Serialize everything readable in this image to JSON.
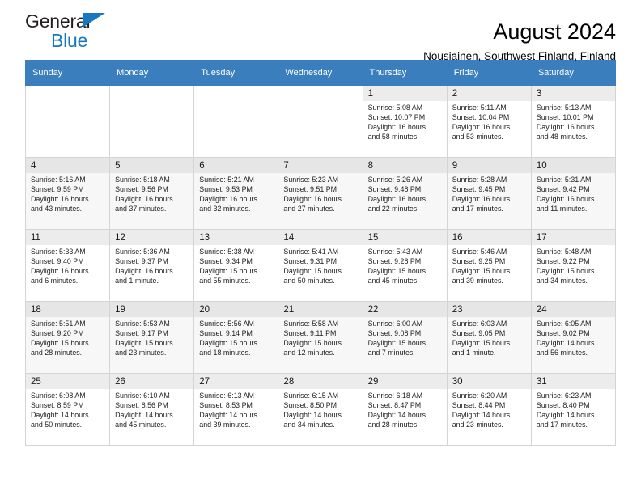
{
  "brand": {
    "line1": "General",
    "line2": "Blue",
    "accent_color": "#1878be",
    "triangle_icon": "brand-triangle-icon"
  },
  "header": {
    "title": "August 2024",
    "subtitle": "Nousiainen, Southwest Finland, Finland"
  },
  "theme": {
    "header_row_bg": "#3a7ebe",
    "header_row_text": "#ffffff",
    "alt_row_bg": "#f7f7f7",
    "daynum_bg": "#ececec",
    "grid_border": "#d4d4d4"
  },
  "weekdays": [
    "Sunday",
    "Monday",
    "Tuesday",
    "Wednesday",
    "Thursday",
    "Friday",
    "Saturday"
  ],
  "labels": {
    "sunrise": "Sunrise:",
    "sunset": "Sunset:",
    "daylight": "Daylight:"
  },
  "weeks": [
    {
      "alt": false,
      "days": [
        {
          "empty": true
        },
        {
          "empty": true
        },
        {
          "empty": true
        },
        {
          "empty": true
        },
        {
          "day": "1",
          "sunrise": "Sunrise: 5:08 AM",
          "sunset": "Sunset: 10:07 PM",
          "daylight1": "Daylight: 16 hours",
          "daylight2": "and 58 minutes."
        },
        {
          "day": "2",
          "sunrise": "Sunrise: 5:11 AM",
          "sunset": "Sunset: 10:04 PM",
          "daylight1": "Daylight: 16 hours",
          "daylight2": "and 53 minutes."
        },
        {
          "day": "3",
          "sunrise": "Sunrise: 5:13 AM",
          "sunset": "Sunset: 10:01 PM",
          "daylight1": "Daylight: 16 hours",
          "daylight2": "and 48 minutes."
        }
      ]
    },
    {
      "alt": true,
      "days": [
        {
          "day": "4",
          "sunrise": "Sunrise: 5:16 AM",
          "sunset": "Sunset: 9:59 PM",
          "daylight1": "Daylight: 16 hours",
          "daylight2": "and 43 minutes."
        },
        {
          "day": "5",
          "sunrise": "Sunrise: 5:18 AM",
          "sunset": "Sunset: 9:56 PM",
          "daylight1": "Daylight: 16 hours",
          "daylight2": "and 37 minutes."
        },
        {
          "day": "6",
          "sunrise": "Sunrise: 5:21 AM",
          "sunset": "Sunset: 9:53 PM",
          "daylight1": "Daylight: 16 hours",
          "daylight2": "and 32 minutes."
        },
        {
          "day": "7",
          "sunrise": "Sunrise: 5:23 AM",
          "sunset": "Sunset: 9:51 PM",
          "daylight1": "Daylight: 16 hours",
          "daylight2": "and 27 minutes."
        },
        {
          "day": "8",
          "sunrise": "Sunrise: 5:26 AM",
          "sunset": "Sunset: 9:48 PM",
          "daylight1": "Daylight: 16 hours",
          "daylight2": "and 22 minutes."
        },
        {
          "day": "9",
          "sunrise": "Sunrise: 5:28 AM",
          "sunset": "Sunset: 9:45 PM",
          "daylight1": "Daylight: 16 hours",
          "daylight2": "and 17 minutes."
        },
        {
          "day": "10",
          "sunrise": "Sunrise: 5:31 AM",
          "sunset": "Sunset: 9:42 PM",
          "daylight1": "Daylight: 16 hours",
          "daylight2": "and 11 minutes."
        }
      ]
    },
    {
      "alt": false,
      "days": [
        {
          "day": "11",
          "sunrise": "Sunrise: 5:33 AM",
          "sunset": "Sunset: 9:40 PM",
          "daylight1": "Daylight: 16 hours",
          "daylight2": "and 6 minutes."
        },
        {
          "day": "12",
          "sunrise": "Sunrise: 5:36 AM",
          "sunset": "Sunset: 9:37 PM",
          "daylight1": "Daylight: 16 hours",
          "daylight2": "and 1 minute."
        },
        {
          "day": "13",
          "sunrise": "Sunrise: 5:38 AM",
          "sunset": "Sunset: 9:34 PM",
          "daylight1": "Daylight: 15 hours",
          "daylight2": "and 55 minutes."
        },
        {
          "day": "14",
          "sunrise": "Sunrise: 5:41 AM",
          "sunset": "Sunset: 9:31 PM",
          "daylight1": "Daylight: 15 hours",
          "daylight2": "and 50 minutes."
        },
        {
          "day": "15",
          "sunrise": "Sunrise: 5:43 AM",
          "sunset": "Sunset: 9:28 PM",
          "daylight1": "Daylight: 15 hours",
          "daylight2": "and 45 minutes."
        },
        {
          "day": "16",
          "sunrise": "Sunrise: 5:46 AM",
          "sunset": "Sunset: 9:25 PM",
          "daylight1": "Daylight: 15 hours",
          "daylight2": "and 39 minutes."
        },
        {
          "day": "17",
          "sunrise": "Sunrise: 5:48 AM",
          "sunset": "Sunset: 9:22 PM",
          "daylight1": "Daylight: 15 hours",
          "daylight2": "and 34 minutes."
        }
      ]
    },
    {
      "alt": true,
      "days": [
        {
          "day": "18",
          "sunrise": "Sunrise: 5:51 AM",
          "sunset": "Sunset: 9:20 PM",
          "daylight1": "Daylight: 15 hours",
          "daylight2": "and 28 minutes."
        },
        {
          "day": "19",
          "sunrise": "Sunrise: 5:53 AM",
          "sunset": "Sunset: 9:17 PM",
          "daylight1": "Daylight: 15 hours",
          "daylight2": "and 23 minutes."
        },
        {
          "day": "20",
          "sunrise": "Sunrise: 5:56 AM",
          "sunset": "Sunset: 9:14 PM",
          "daylight1": "Daylight: 15 hours",
          "daylight2": "and 18 minutes."
        },
        {
          "day": "21",
          "sunrise": "Sunrise: 5:58 AM",
          "sunset": "Sunset: 9:11 PM",
          "daylight1": "Daylight: 15 hours",
          "daylight2": "and 12 minutes."
        },
        {
          "day": "22",
          "sunrise": "Sunrise: 6:00 AM",
          "sunset": "Sunset: 9:08 PM",
          "daylight1": "Daylight: 15 hours",
          "daylight2": "and 7 minutes."
        },
        {
          "day": "23",
          "sunrise": "Sunrise: 6:03 AM",
          "sunset": "Sunset: 9:05 PM",
          "daylight1": "Daylight: 15 hours",
          "daylight2": "and 1 minute."
        },
        {
          "day": "24",
          "sunrise": "Sunrise: 6:05 AM",
          "sunset": "Sunset: 9:02 PM",
          "daylight1": "Daylight: 14 hours",
          "daylight2": "and 56 minutes."
        }
      ]
    },
    {
      "alt": false,
      "days": [
        {
          "day": "25",
          "sunrise": "Sunrise: 6:08 AM",
          "sunset": "Sunset: 8:59 PM",
          "daylight1": "Daylight: 14 hours",
          "daylight2": "and 50 minutes."
        },
        {
          "day": "26",
          "sunrise": "Sunrise: 6:10 AM",
          "sunset": "Sunset: 8:56 PM",
          "daylight1": "Daylight: 14 hours",
          "daylight2": "and 45 minutes."
        },
        {
          "day": "27",
          "sunrise": "Sunrise: 6:13 AM",
          "sunset": "Sunset: 8:53 PM",
          "daylight1": "Daylight: 14 hours",
          "daylight2": "and 39 minutes."
        },
        {
          "day": "28",
          "sunrise": "Sunrise: 6:15 AM",
          "sunset": "Sunset: 8:50 PM",
          "daylight1": "Daylight: 14 hours",
          "daylight2": "and 34 minutes."
        },
        {
          "day": "29",
          "sunrise": "Sunrise: 6:18 AM",
          "sunset": "Sunset: 8:47 PM",
          "daylight1": "Daylight: 14 hours",
          "daylight2": "and 28 minutes."
        },
        {
          "day": "30",
          "sunrise": "Sunrise: 6:20 AM",
          "sunset": "Sunset: 8:44 PM",
          "daylight1": "Daylight: 14 hours",
          "daylight2": "and 23 minutes."
        },
        {
          "day": "31",
          "sunrise": "Sunrise: 6:23 AM",
          "sunset": "Sunset: 8:40 PM",
          "daylight1": "Daylight: 14 hours",
          "daylight2": "and 17 minutes."
        }
      ]
    }
  ]
}
